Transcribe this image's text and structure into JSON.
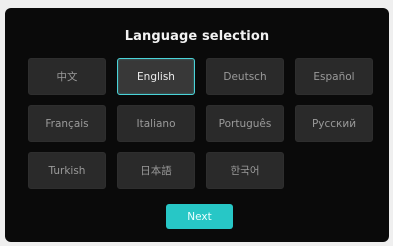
{
  "screen": {
    "title": "Language selection",
    "languages": [
      {
        "label": "中文",
        "selected": false
      },
      {
        "label": "English",
        "selected": true
      },
      {
        "label": "Deutsch",
        "selected": false
      },
      {
        "label": "Español",
        "selected": false
      },
      {
        "label": "Français",
        "selected": false
      },
      {
        "label": "Italiano",
        "selected": false
      },
      {
        "label": "Português",
        "selected": false
      },
      {
        "label": "Русский",
        "selected": false
      },
      {
        "label": "Turkish",
        "selected": false
      },
      {
        "label": "日本語",
        "selected": false
      },
      {
        "label": "한국어",
        "selected": false
      }
    ],
    "next_label": "Next"
  },
  "colors": {
    "accent": "#27c7c6",
    "selected_border": "#4ad3d8",
    "button_bg": "#2a2a2a",
    "screen_bg": "#0a0a0a"
  }
}
